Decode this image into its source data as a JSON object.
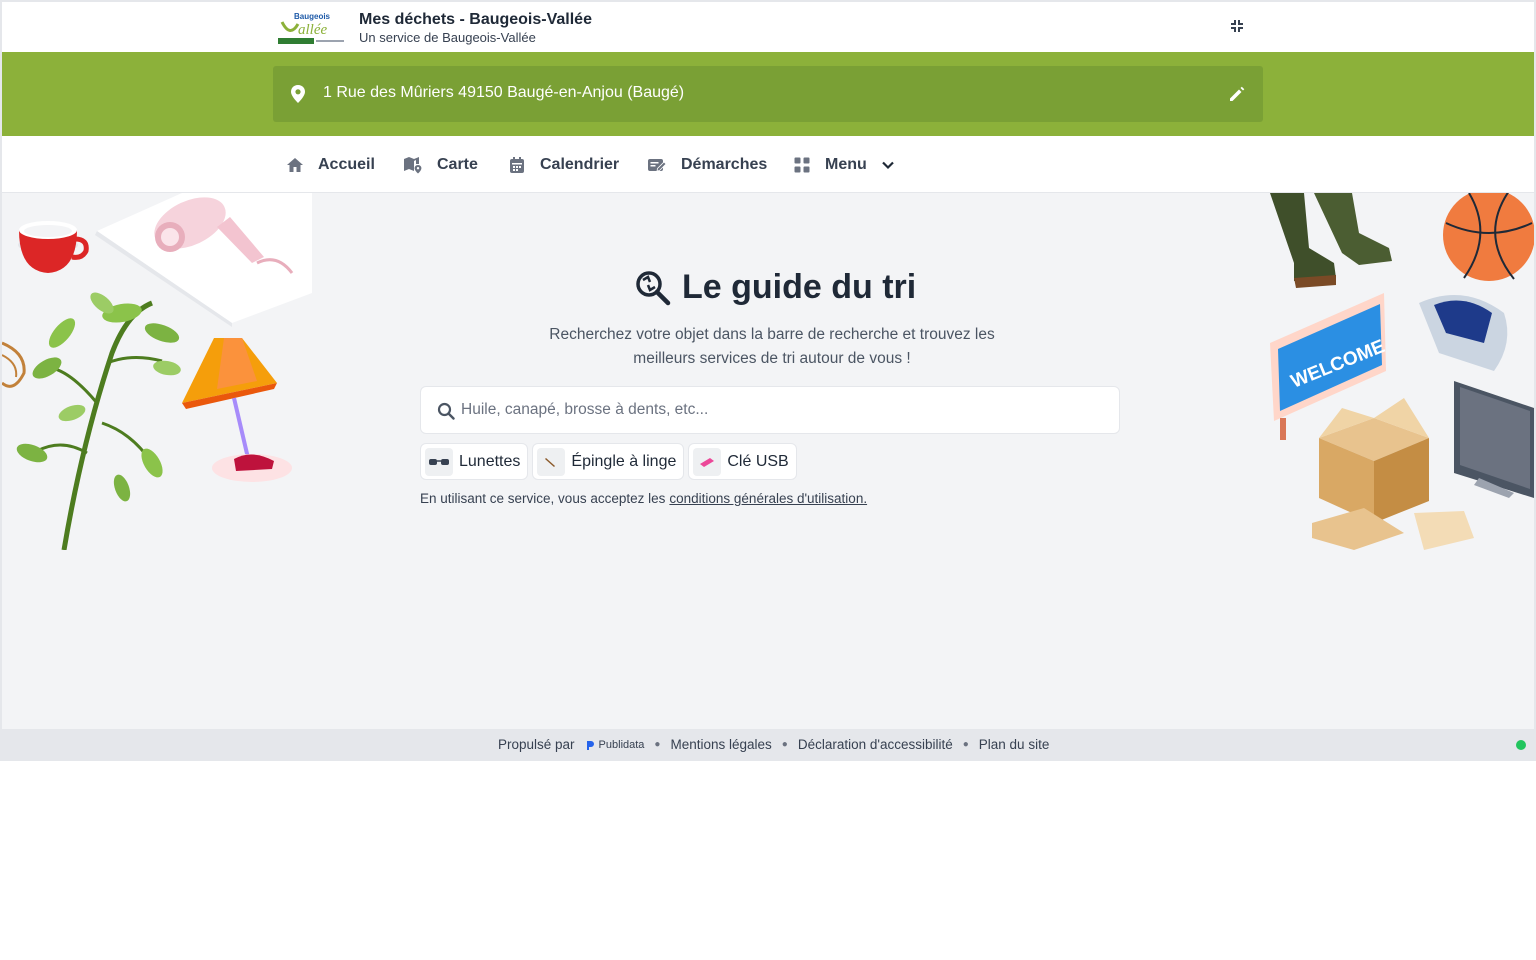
{
  "header": {
    "logo_text": "Baugeois Vallée",
    "title": "Mes déchets - Baugeois-Vallée",
    "subtitle": "Un service de Baugeois-Vallée",
    "collapse_icon": "collapse-icon"
  },
  "address": {
    "text": "1 Rue des Mûriers 49150 Baugé-en-Anjou (Baugé)",
    "pin_icon": "location-pin-icon",
    "edit_icon": "pencil-icon"
  },
  "nav": {
    "items": [
      {
        "label": "Accueil",
        "icon": "home-icon"
      },
      {
        "label": "Carte",
        "icon": "map-icon"
      },
      {
        "label": "Calendrier",
        "icon": "calendar-icon"
      },
      {
        "label": "Démarches",
        "icon": "form-icon"
      },
      {
        "label": "Menu",
        "icon": "grid-icon"
      }
    ]
  },
  "hero": {
    "title": "Le guide du tri",
    "lead": "Recherchez votre objet dans la barre de recherche et trouvez les meilleurs services de tri autour de vous !",
    "search_placeholder": "Huile, canapé, brosse à dents, etc...",
    "suggestions": [
      "Lunettes",
      "Épingle à linge",
      "Clé USB"
    ],
    "terms_prefix": "En utilisant ce service, vous acceptez les",
    "terms_link": "conditions générales d'utilisation."
  },
  "footer": {
    "powered_by": "Propulsé par",
    "brand": "Publidata",
    "links": [
      "Mentions légales",
      "Déclaration d'accessibilité",
      "Plan du site"
    ],
    "status_color": "#22c55e"
  },
  "colors": {
    "brand_green": "#8cb13a",
    "brand_green_dark": "#7aa035"
  }
}
